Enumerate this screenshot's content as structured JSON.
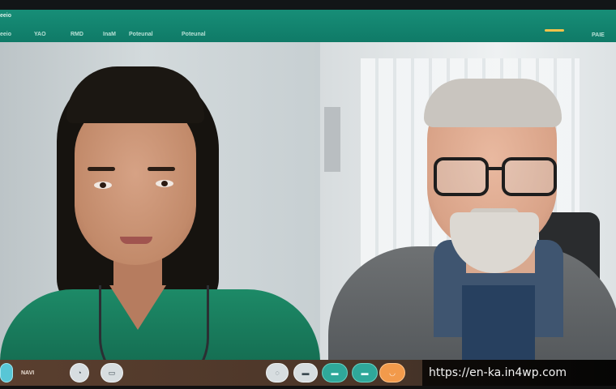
{
  "app": {
    "title": "eeio"
  },
  "topbar": {
    "nav": [
      "YAO",
      "RMD",
      "InaM",
      "Poteunal"
    ],
    "nav_right": "PAIE",
    "status_color": "#f3c24a"
  },
  "participants": [
    {
      "role": "clinician",
      "attire": "green scrubs with stethoscope"
    },
    {
      "role": "patient",
      "attire": "gray sweater, glasses"
    }
  ],
  "controls": {
    "label": "NAVI",
    "buttons": [
      {
        "name": "indicator",
        "icon": "dot-icon"
      },
      {
        "name": "mic",
        "icon": "mic-icon"
      },
      {
        "name": "camera",
        "icon": "camera-icon"
      },
      {
        "name": "chat",
        "icon": "chat-icon"
      },
      {
        "name": "share",
        "icon": "share-icon"
      },
      {
        "name": "participants",
        "icon": "people-icon"
      },
      {
        "name": "settings",
        "icon": "gear-icon"
      },
      {
        "name": "end",
        "icon": "end-call-icon"
      }
    ],
    "accent_colors": {
      "teal": "#2fa89a",
      "orange": "#f29a4b"
    }
  },
  "watermark": {
    "url": "https://en-ka.in4wp.com"
  }
}
